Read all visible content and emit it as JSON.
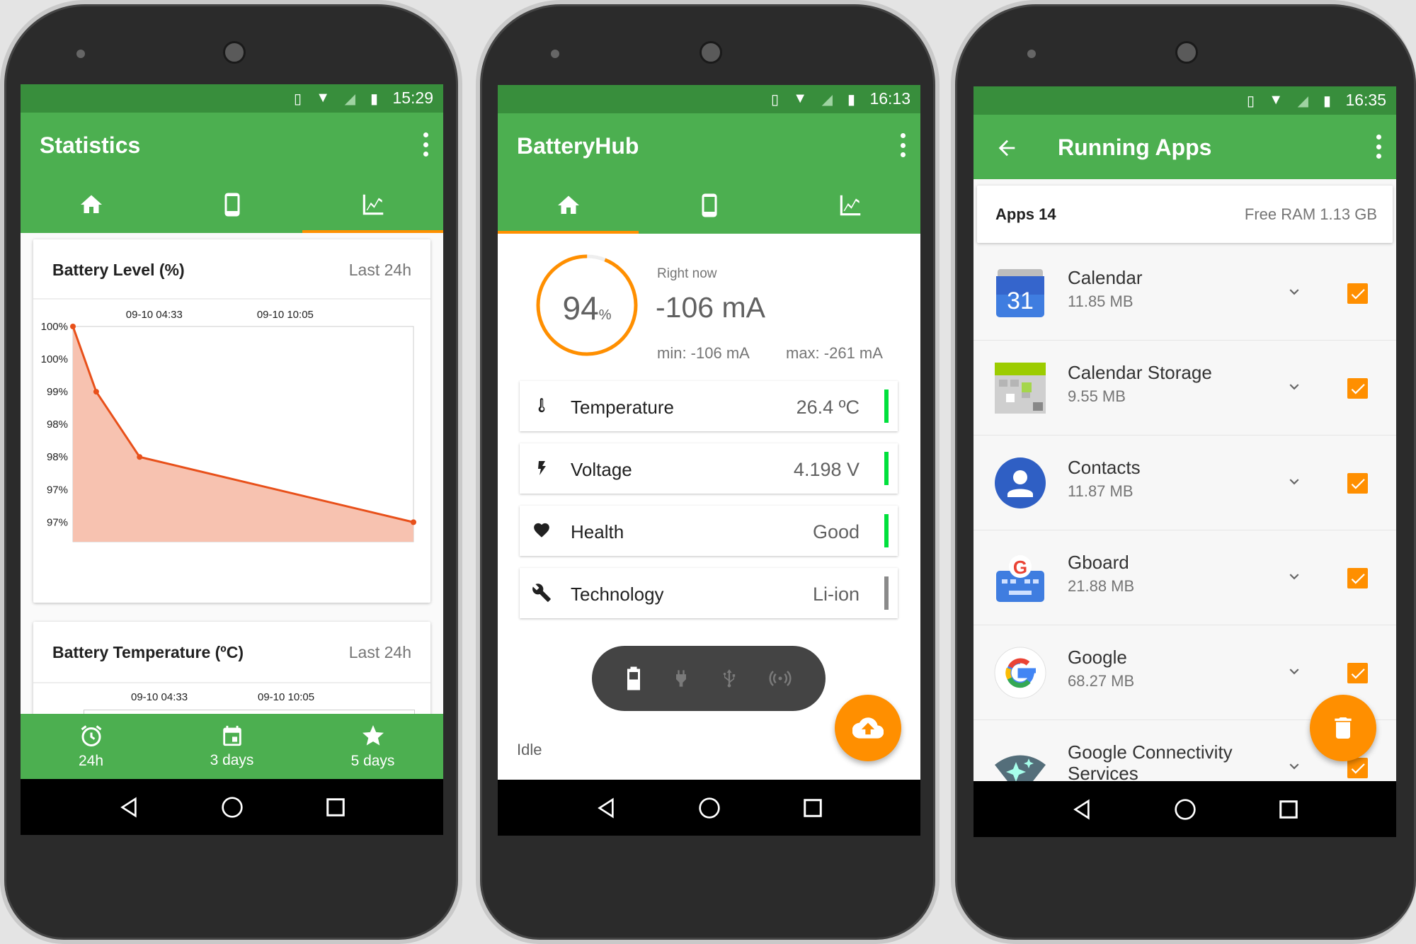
{
  "colors": {
    "green": "#4caf50",
    "dark_green": "#388e3c",
    "orange": "#ff8f00",
    "line": "#e8501a",
    "fill": "#f7c2b0",
    "ok_bar": "#00e03c",
    "neutral_bar": "#8a8a8a"
  },
  "phone1": {
    "status_time": "15:29",
    "title": "Statistics",
    "tabs": [
      {
        "icon": "home-icon"
      },
      {
        "icon": "phone-icon"
      },
      {
        "icon": "chart-icon",
        "active": true
      }
    ],
    "card1": {
      "title": "Battery Level (%)",
      "range": "Last 24h"
    },
    "card2": {
      "title": "Battery Temperature (ºC)",
      "range": "Last 24h",
      "x_tick_labels": [
        "09-10 04:33",
        "09-10 10:05"
      ]
    },
    "bottom_nav": [
      {
        "icon": "alarm-icon",
        "label": "24h"
      },
      {
        "icon": "calendar-icon",
        "label": "3 days"
      },
      {
        "icon": "star-icon",
        "label": "5 days"
      }
    ]
  },
  "chart_data": {
    "type": "area",
    "title": "Battery Level (%)",
    "x": [
      "09-10 01:07",
      "09-10 02:06",
      "09-10 03:56",
      "09-10 15:30"
    ],
    "values": [
      100,
      99,
      98,
      97
    ],
    "x_tick_labels": [
      "09-10 04:33",
      "09-10 10:05"
    ],
    "x_ticks": [
      "09-10 04:33",
      "09-10 10:05"
    ],
    "y_ticks": [
      100,
      99.5,
      99,
      98.5,
      98,
      97.5,
      97
    ],
    "y_tick_labels": [
      "100%",
      "100%",
      "99%",
      "98%",
      "98%",
      "97%",
      "97%"
    ],
    "ylim": [
      96.7,
      100
    ],
    "xlim": [
      "09-10 01:07",
      "09-10 15:30"
    ],
    "grid": false
  },
  "phone2": {
    "status_time": "16:13",
    "title": "BatteryHub",
    "tabs": [
      {
        "icon": "home-icon",
        "active": true
      },
      {
        "icon": "phone-icon"
      },
      {
        "icon": "chart-icon"
      }
    ],
    "level": {
      "value": "94",
      "unit": "%",
      "fraction": 0.94
    },
    "now_label": "Right now",
    "current": "-106 mA",
    "min": "min: -106 mA",
    "max": "max: -261 mA",
    "rows": [
      {
        "icon": "thermometer-icon",
        "label": "Temperature",
        "value": "26.4 ºC",
        "status": "ok"
      },
      {
        "icon": "bolt-icon",
        "label": "Voltage",
        "value": "4.198 V",
        "status": "ok"
      },
      {
        "icon": "heart-icon",
        "label": "Health",
        "value": "Good",
        "status": "ok"
      },
      {
        "icon": "wrench-icon",
        "label": "Technology",
        "value": "Li-ion",
        "status": "neutral"
      }
    ],
    "sources": [
      {
        "icon": "battery-icon",
        "active": true
      },
      {
        "icon": "plug-icon"
      },
      {
        "icon": "usb-icon"
      },
      {
        "icon": "wireless-icon"
      }
    ],
    "state": "Idle",
    "fab_icon": "cloud-upload-icon"
  },
  "phone3": {
    "status_time": "16:35",
    "title": "Running Apps",
    "apps_count": "Apps 14",
    "free_ram": "Free RAM 1.13 GB",
    "apps": [
      {
        "name": "Calendar",
        "size": "11.85 MB",
        "icon": "calendar-app-icon",
        "checked": true
      },
      {
        "name": "Calendar Storage",
        "size": "9.55 MB",
        "icon": "calendar-storage-icon",
        "checked": true
      },
      {
        "name": "Contacts",
        "size": "11.87 MB",
        "icon": "contacts-icon",
        "checked": true
      },
      {
        "name": "Gboard",
        "size": "21.88 MB",
        "icon": "gboard-icon",
        "checked": true
      },
      {
        "name": "Google",
        "size": "68.27 MB",
        "icon": "google-icon",
        "checked": true
      },
      {
        "name": "Google Connectivity Services",
        "size": "",
        "icon": "connectivity-icon",
        "checked": true
      }
    ],
    "calendar_day": "31",
    "fab_icon": "trash-icon"
  }
}
